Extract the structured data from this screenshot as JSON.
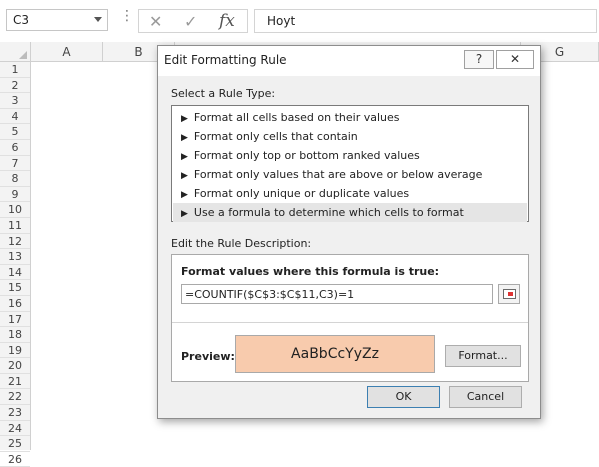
{
  "formula_bar": {
    "name_box": "C3",
    "more_icon": "⋮",
    "cancel_icon": "x-icon",
    "enter_icon": "check-icon",
    "fx_label": "fx",
    "content": "Hoyt"
  },
  "grid": {
    "columns": [
      "A",
      "B",
      "G"
    ],
    "rows": [
      "1",
      "2",
      "3",
      "4",
      "5",
      "6",
      "7",
      "8",
      "9",
      "10",
      "11",
      "12",
      "13",
      "14",
      "15",
      "16",
      "17",
      "18",
      "19",
      "20",
      "21",
      "22",
      "23",
      "24",
      "25",
      "26"
    ]
  },
  "dialog": {
    "title": "Edit Formatting Rule",
    "help_label": "?",
    "close_label": "✕",
    "rule_type_label": "Select a Rule Type:",
    "rule_types": [
      "Format all cells based on their values",
      "Format only cells that contain",
      "Format only top or bottom ranked values",
      "Format only values that are above or below average",
      "Format only unique or duplicate values",
      "Use a formula to determine which cells to format"
    ],
    "selected_rule_index": 5,
    "description_label": "Edit the Rule Description:",
    "formula_label": "Format values where this formula is true:",
    "formula_value": "=COUNTIF($C$3:$C$11,C3)=1",
    "preview_label": "Preview:",
    "preview_text": "AaBbCcYyZz",
    "preview_fill": "#f8cbad",
    "format_button": "Format...",
    "ok_button": "OK",
    "cancel_button": "Cancel"
  }
}
